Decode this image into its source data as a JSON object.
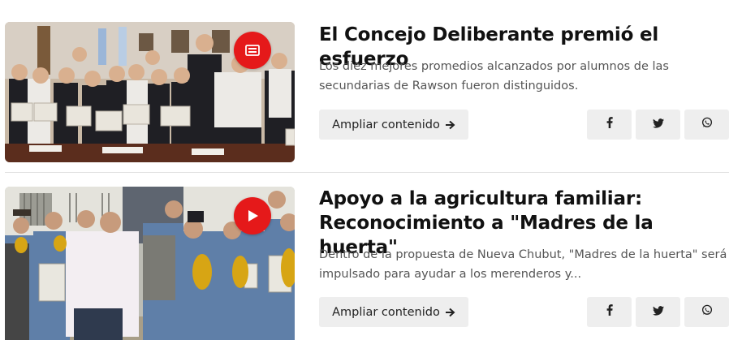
{
  "articles": [
    {
      "title": "El Concejo Deliberante premió el esfuerzo",
      "excerpt": "Los diez mejores promedios alcanzados por alumnos de las secundarias de Rawson fueron distinguidos.",
      "more_label": "Ampliar contenido",
      "media_icon": "gallery-icon",
      "share": [
        "facebook-icon",
        "twitter-icon",
        "whatsapp-icon"
      ]
    },
    {
      "title": "Apoyo a la agricultura familiar: Reconocimiento a \"Madres de la huerta\"",
      "excerpt": "Dentro de la propuesta de Nueva Chubut, \"Madres de la huerta\" será impulsado para ayudar a los merenderos y...",
      "more_label": "Ampliar contenido",
      "media_icon": "play-icon",
      "share": [
        "facebook-icon",
        "twitter-icon",
        "whatsapp-icon"
      ]
    }
  ],
  "colors": {
    "badge": "#e5191a",
    "button_bg": "#eeeeee",
    "title": "#111111",
    "excerpt": "#555555"
  }
}
